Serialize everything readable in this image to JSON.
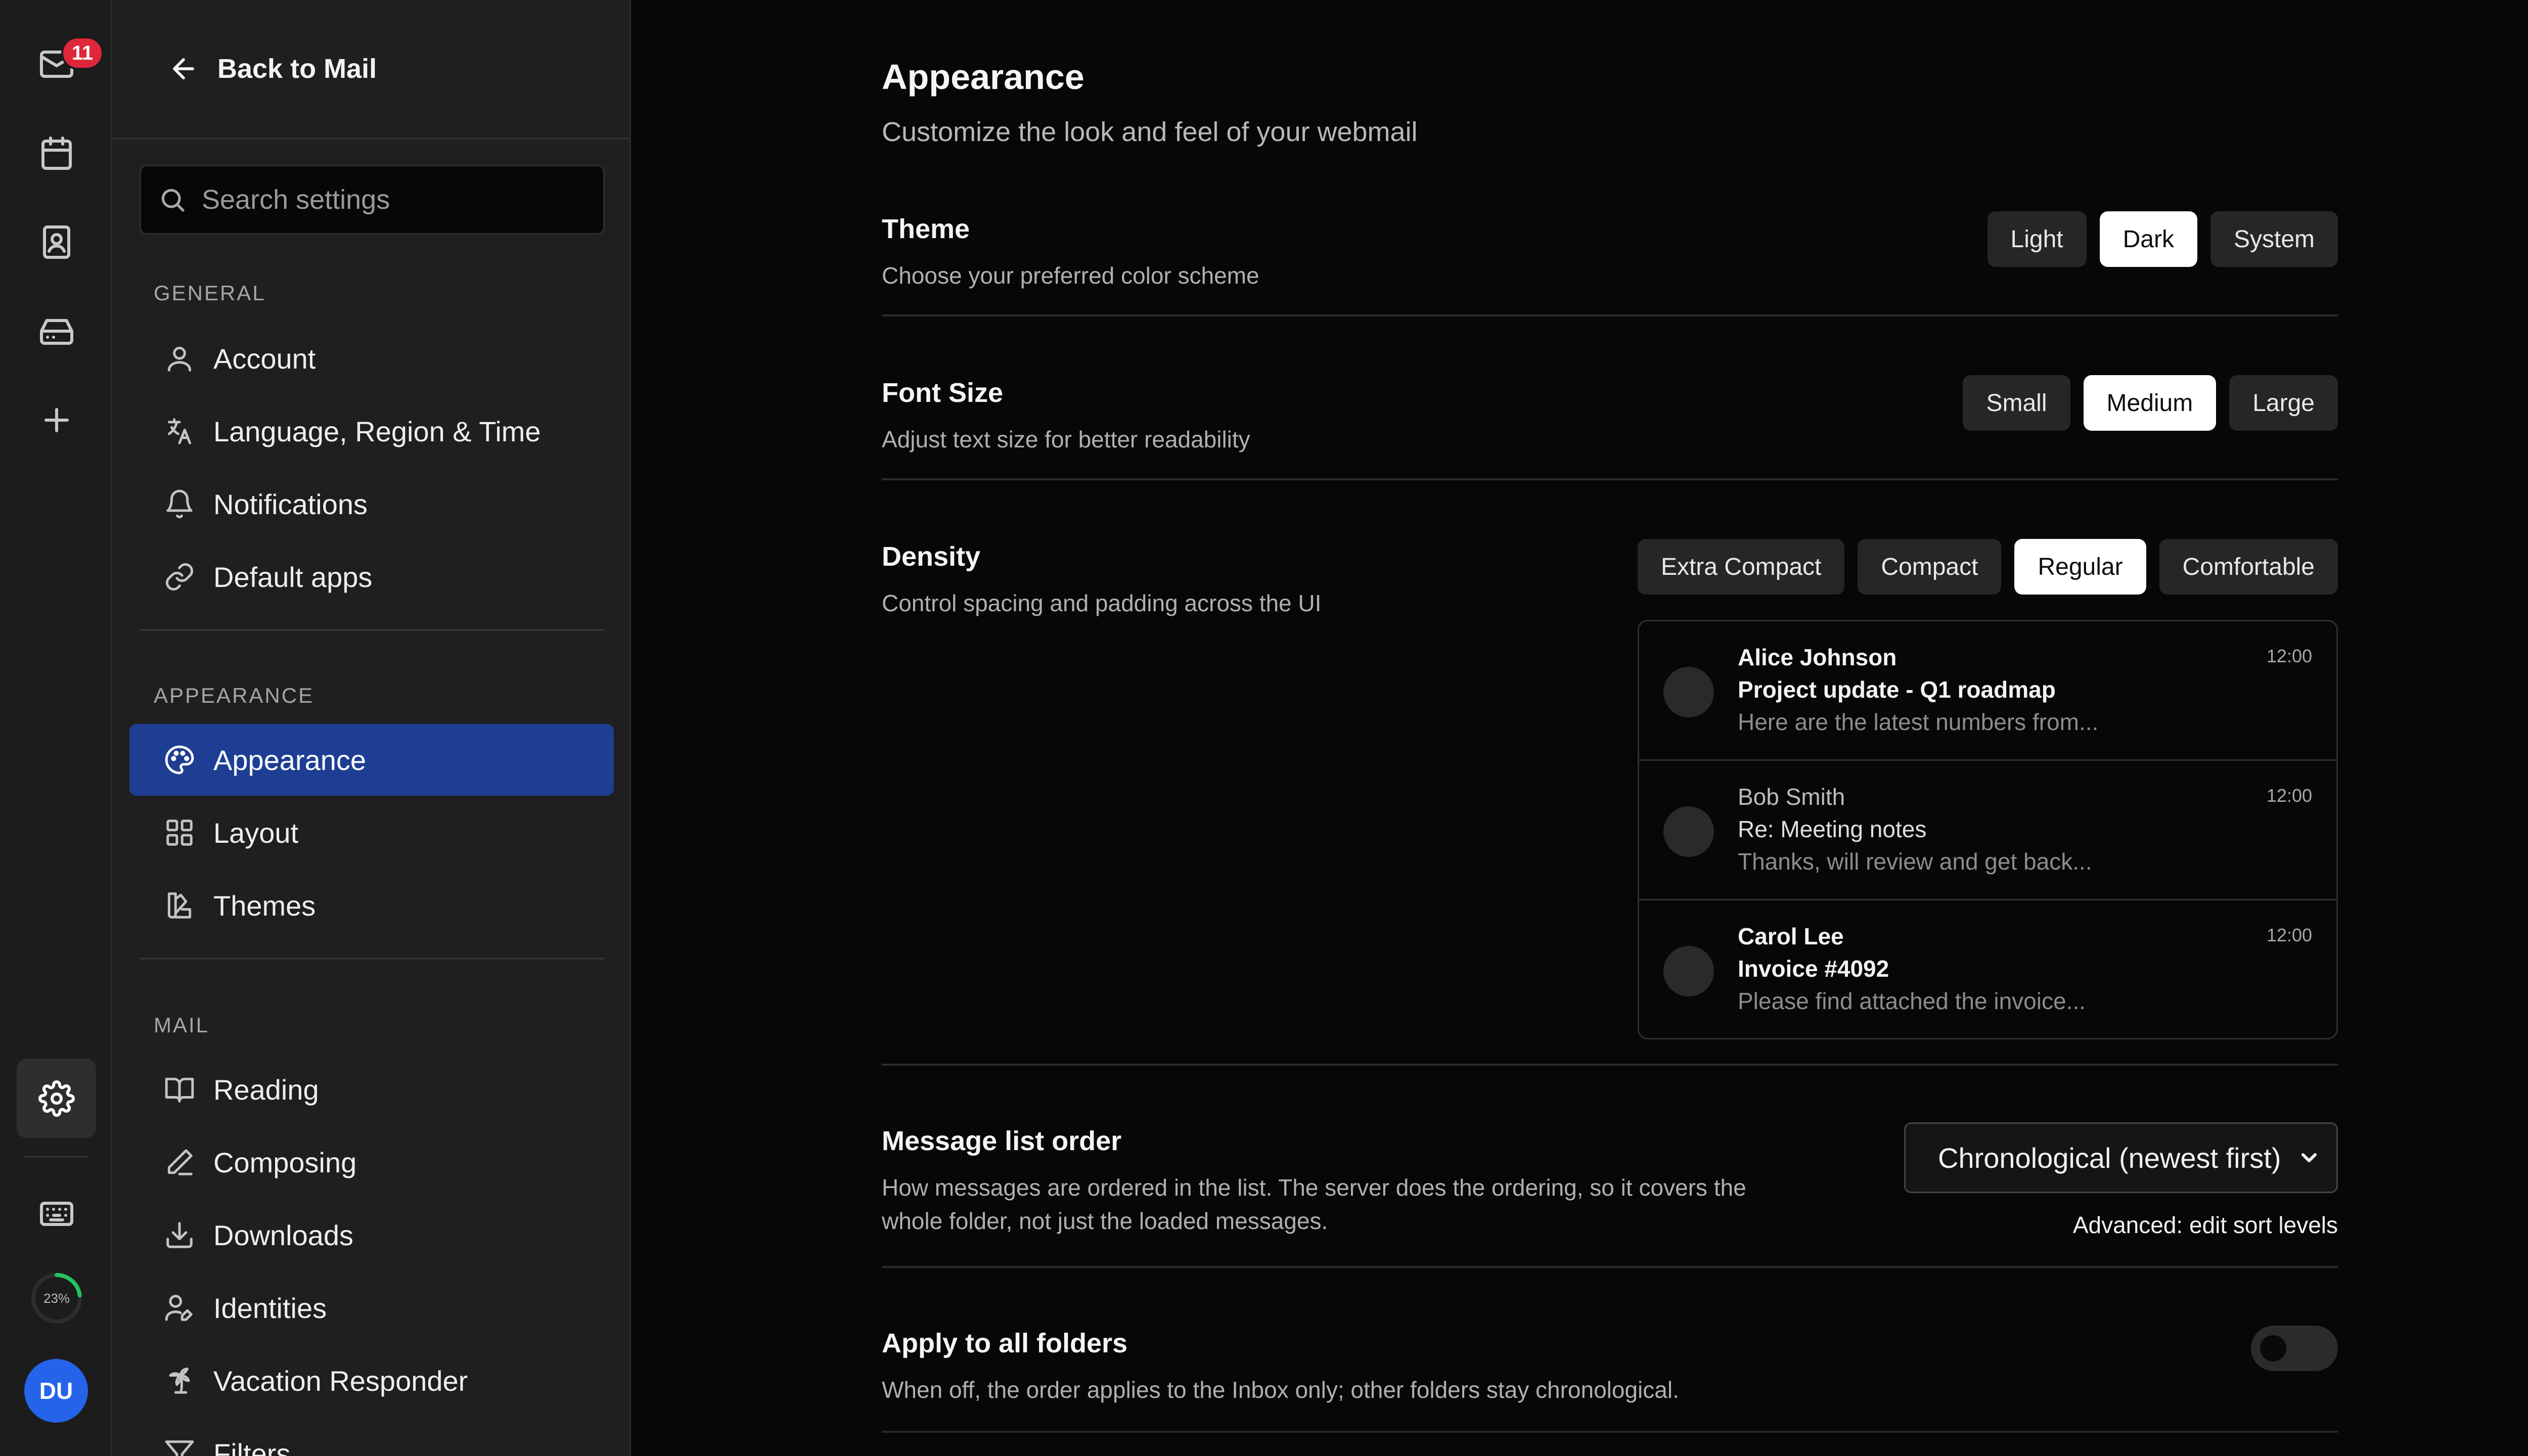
{
  "rail": {
    "mail_badge": "11",
    "quota_percent": 23,
    "quota_label": "23%",
    "avatar_initials": "DU",
    "items": [
      "mail-icon",
      "calendar-icon",
      "contacts-icon",
      "drive-icon",
      "plus-icon",
      "settings-icon",
      "keyboard-icon"
    ]
  },
  "sidebar": {
    "back_label": "Back to Mail",
    "search_placeholder": "Search settings",
    "sections": [
      {
        "heading": "GENERAL",
        "items": [
          {
            "label": "Account",
            "icon": "user-icon"
          },
          {
            "label": "Language, Region & Time",
            "icon": "translate-icon"
          },
          {
            "label": "Notifications",
            "icon": "bell-icon"
          },
          {
            "label": "Default apps",
            "icon": "link-icon"
          }
        ]
      },
      {
        "heading": "APPEARANCE",
        "items": [
          {
            "label": "Appearance",
            "icon": "palette-icon",
            "active": true
          },
          {
            "label": "Layout",
            "icon": "grid-icon"
          },
          {
            "label": "Themes",
            "icon": "swatch-icon"
          }
        ]
      },
      {
        "heading": "MAIL",
        "items": [
          {
            "label": "Reading",
            "icon": "book-icon"
          },
          {
            "label": "Composing",
            "icon": "pen-icon"
          },
          {
            "label": "Downloads",
            "icon": "download-icon"
          },
          {
            "label": "Identities",
            "icon": "identity-icon"
          },
          {
            "label": "Vacation Responder",
            "icon": "palm-tree-icon"
          },
          {
            "label": "Filters",
            "icon": "filter-icon"
          }
        ]
      }
    ]
  },
  "main": {
    "title": "Appearance",
    "subtitle": "Customize the look and feel of your webmail",
    "theme": {
      "title": "Theme",
      "desc": "Choose your preferred color scheme",
      "options": [
        "Light",
        "Dark",
        "System"
      ],
      "selected": "Dark"
    },
    "font_size": {
      "title": "Font Size",
      "desc": "Adjust text size for better readability",
      "options": [
        "Small",
        "Medium",
        "Large"
      ],
      "selected": "Medium"
    },
    "density": {
      "title": "Density",
      "desc": "Control spacing and padding across the UI",
      "options": [
        "Extra Compact",
        "Compact",
        "Regular",
        "Comfortable"
      ],
      "selected": "Regular",
      "preview": [
        {
          "from": "Alice Johnson",
          "subject": "Project update - Q1 roadmap",
          "snippet": "Here are the latest numbers from...",
          "time": "12:00",
          "unread": true
        },
        {
          "from": "Bob Smith",
          "subject": "Re: Meeting notes",
          "snippet": "Thanks, will review and get back...",
          "time": "12:00",
          "unread": false
        },
        {
          "from": "Carol Lee",
          "subject": "Invoice #4092",
          "snippet": "Please find attached the invoice...",
          "time": "12:00",
          "unread": true
        }
      ]
    },
    "order": {
      "title": "Message list order",
      "desc_line1": "How messages are ordered in the list. The server does the ordering, so it covers the",
      "desc_line2": "whole folder, not just the loaded messages.",
      "selected": "Chronological (newest first)",
      "advanced_link": "Advanced: edit sort levels"
    },
    "apply_all": {
      "title": "Apply to all folders",
      "desc": "When off, the order applies to the Inbox only; other folders stay chronological.",
      "enabled": false
    }
  },
  "colors": {
    "accent": "#1e3e93",
    "badge": "#e0263b",
    "avatar": "#2563eb",
    "quota": "#22c55e"
  }
}
